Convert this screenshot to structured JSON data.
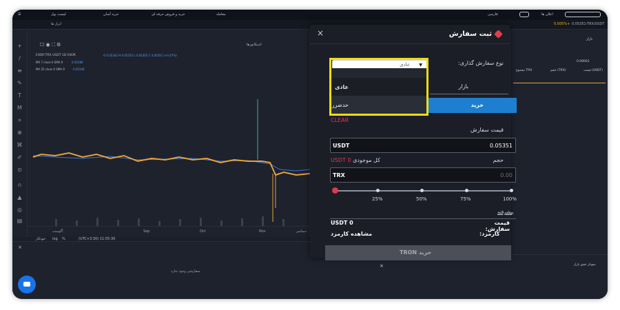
{
  "topbar": {
    "t1": "لیست پول",
    "t2": "خرید آسان",
    "t3": "خرید و فروش حرفه ای",
    "t4": "معامله",
    "lang": "فارسی",
    "t5": "اعلان ها"
  },
  "toolbar2": {
    "tools": "ابزار ها",
    "pair": "0.05351-TRX/USDT",
    "pct": "0.505%+"
  },
  "chart": {
    "symbol": "EXOR:TRX USDT 1D EXOR",
    "ohlc": "O 0.05342 H 0.05355 L 0.05305 C 0.05351 (+0.47%)",
    "ma7": "MA 7 close 0 SMA 9",
    "ma7_val": "0.05380",
    "ma25": "MA 25 close 0 SMA 9",
    "ma25_val": "0.05340",
    "indicators": "اندیکاتورها",
    "ts": "(UTC+3:30) 11:55:30",
    "log": "log",
    "pct": "%",
    "auto": "خودکار",
    "months": [
      "آگوست",
      "Sep",
      "Oct",
      "Nov",
      "دسامبر"
    ]
  },
  "lower_left": {
    "empty": "سفارشی وجود ندارد"
  },
  "right_panel": {
    "market": "بازار",
    "price_hdr": "قیمت (USDT)",
    "vol_hdr": "حجم (TRX)",
    "total_hdr": "مجموع TRX",
    "depth_title": "نمودار عمق بازار",
    "price_filter": "0.00001"
  },
  "modal": {
    "title": "ثبت سفارش",
    "close": "×",
    "order_type_label": "نوع سفارش گذاری:",
    "order_type_value": "عادی",
    "options": [
      "عادی",
      "حدضرر"
    ],
    "tab_market": "بازار",
    "tab_buy": "خرید",
    "clear": "CLEAR",
    "price_label": "قیمت سفارش",
    "price_unit": "USDT",
    "price_value": "0.05351",
    "volume_label": "حجم",
    "balance_label": "کل موجودی",
    "balance_value": "USDT 0",
    "volume_unit": "TRX",
    "volume_placeholder": "0.00",
    "slider_ticks": [
      "25%",
      "50%",
      "75%",
      "100%"
    ],
    "slider_value_pct": 0,
    "advanced": "پیشرفته",
    "summary_price_label": "قیمت سفارش:",
    "summary_price_value": "USDT 0",
    "fee_label": "کارمزد:",
    "fee_value": "مشاهده کارمزد",
    "submit": "خرید TRON"
  }
}
